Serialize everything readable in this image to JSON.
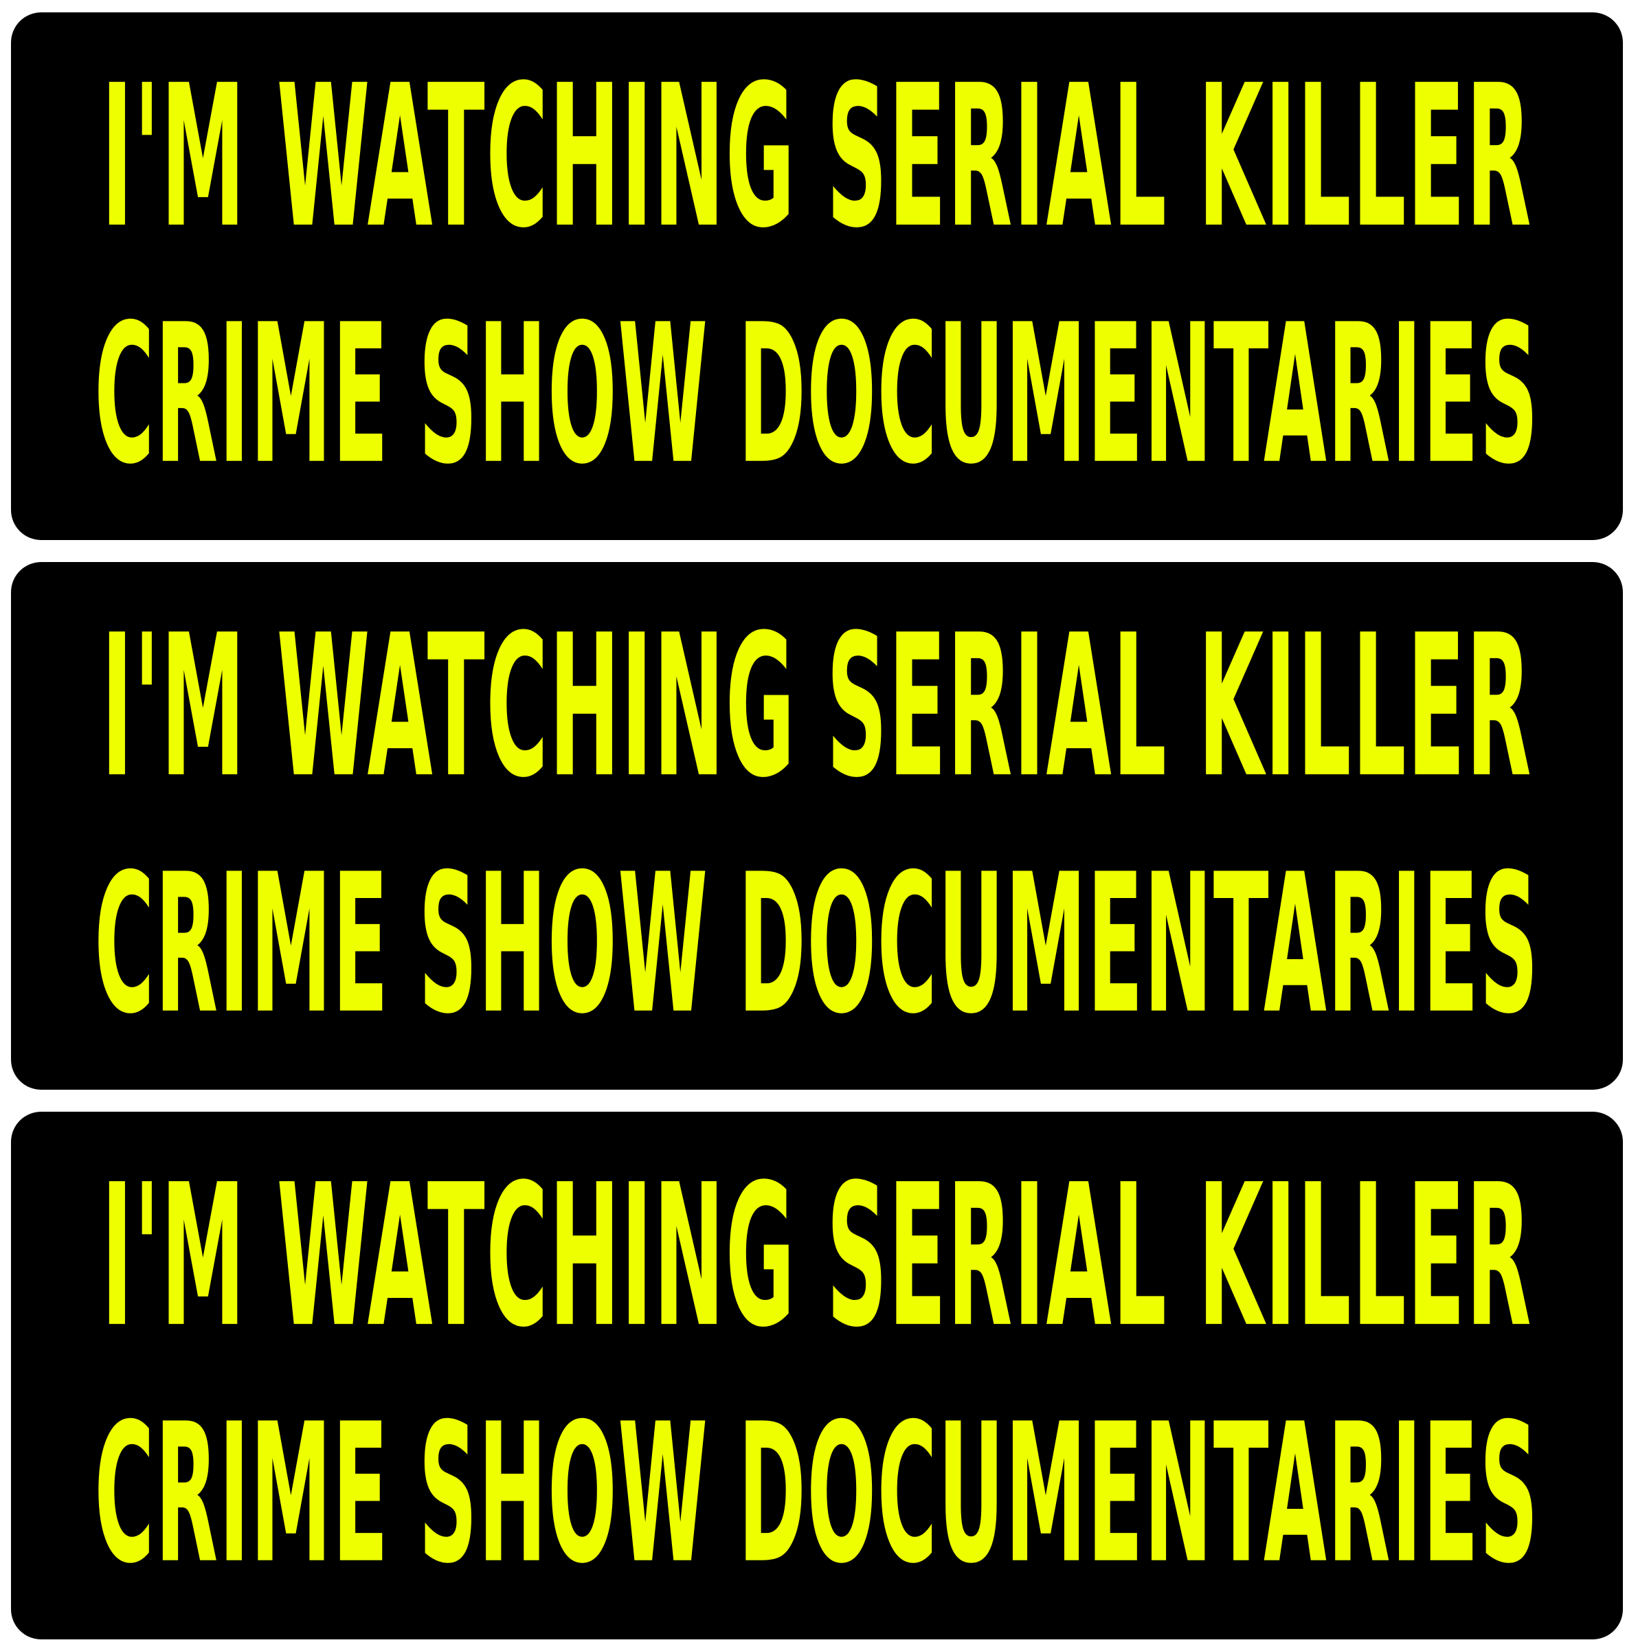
{
  "colors": {
    "background": "#ffffff",
    "sticker": "#000000",
    "text": "#eeff00"
  },
  "stickers": [
    {
      "line1": "I'M WATCHING SERIAL KILLER",
      "line2": "CRIME SHOW DOCUMENTARIES"
    },
    {
      "line1": "I'M WATCHING SERIAL KILLER",
      "line2": "CRIME SHOW DOCUMENTARIES"
    },
    {
      "line1": "I'M WATCHING SERIAL KILLER",
      "line2": "CRIME SHOW DOCUMENTARIES"
    }
  ]
}
